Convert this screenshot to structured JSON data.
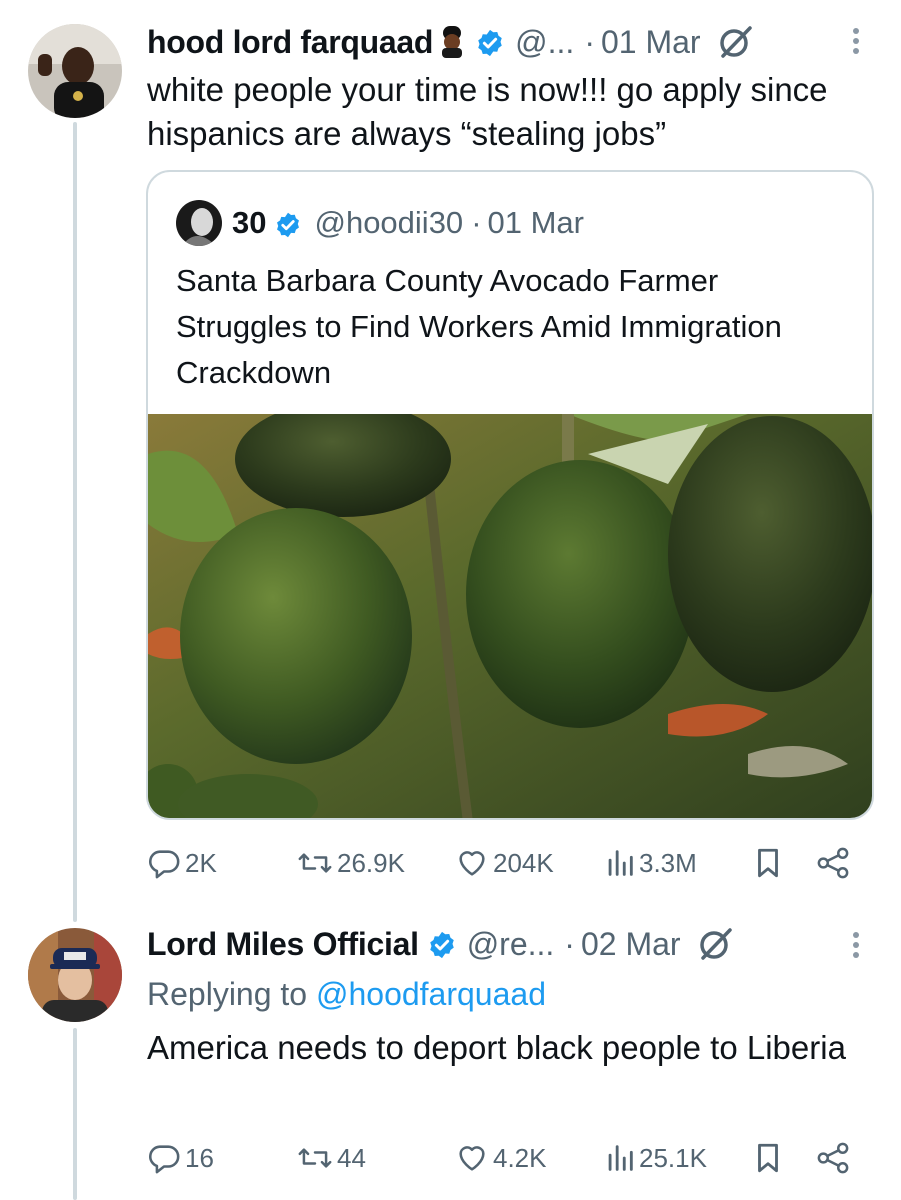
{
  "tweets": [
    {
      "author_name": "hood lord farquaad",
      "handle": "@...",
      "separator": "·",
      "date": "01 Mar",
      "text": "white people your time is now!!! go apply since hispanics are always “stealing jobs”",
      "quote": {
        "author_name": "30",
        "handle": "@hoodii30",
        "separator": "·",
        "date": "01 Mar",
        "text": "Santa Barbara County Avocado Farmer Struggles to Find Workers Amid Immigration Crackdown",
        "image_icon": "avocado-photo"
      },
      "stats": {
        "replies": "2K",
        "reposts": "26.9K",
        "likes": "204K",
        "views": "3.3M"
      }
    },
    {
      "author_name": "Lord Miles Official",
      "handle": "@re...",
      "separator": "·",
      "date": "02 Mar",
      "reply_prefix": "Replying to",
      "reply_handle": "@hoodfarquaad",
      "text": "America needs to deport black people to Liberia",
      "stats": {
        "replies": "16",
        "reposts": "44",
        "likes": "4.2K",
        "views": "25.1K"
      }
    }
  ],
  "icons": {
    "reply": "reply-icon",
    "repost": "repost-icon",
    "like": "like-icon",
    "views": "views-icon",
    "bookmark": "bookmark-icon",
    "share": "share-icon",
    "grok": "grok-icon",
    "more": "more-icon",
    "verified": "verified-icon"
  },
  "colors": {
    "text": "#0f1419",
    "muted": "#536471",
    "link": "#1d9bf0",
    "verified": "#1d9bf0",
    "border": "#cfd9de"
  }
}
